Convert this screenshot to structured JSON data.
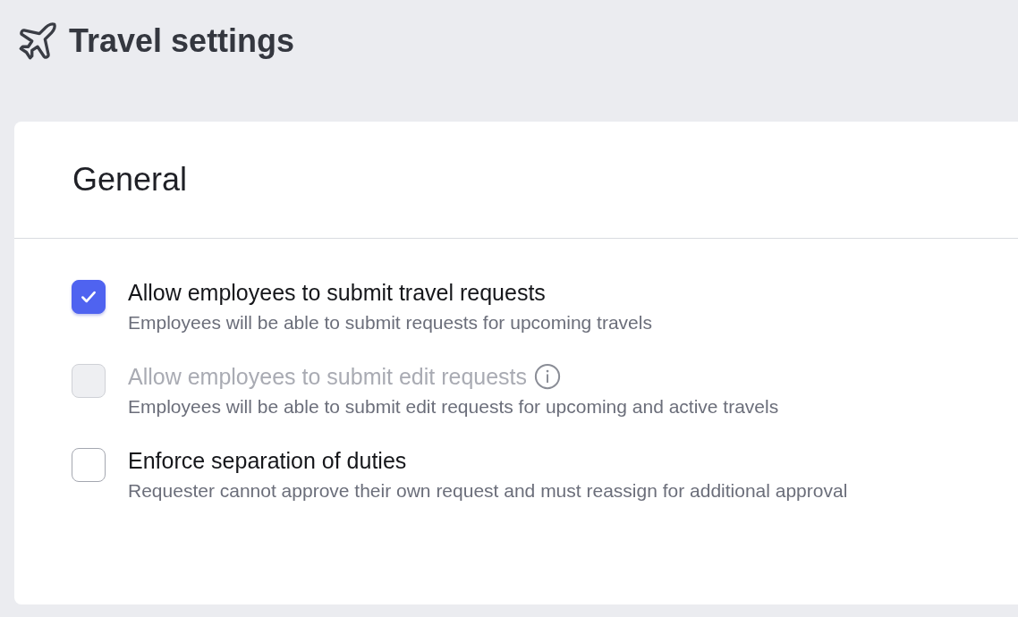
{
  "page": {
    "title": "Travel settings"
  },
  "card": {
    "title": "General",
    "options": [
      {
        "label": "Allow employees to submit travel requests",
        "description": "Employees will be able to submit requests for upcoming travels",
        "checked": true,
        "disabled": false,
        "info_icon": false
      },
      {
        "label": "Allow employees to submit edit requests",
        "description": "Employees will be able to submit edit requests for upcoming and active travels",
        "checked": false,
        "disabled": true,
        "info_icon": true
      },
      {
        "label": "Enforce separation of duties",
        "description": "Requester cannot approve their own request and must reassign for additional approval",
        "checked": false,
        "disabled": false,
        "info_icon": false
      }
    ]
  }
}
